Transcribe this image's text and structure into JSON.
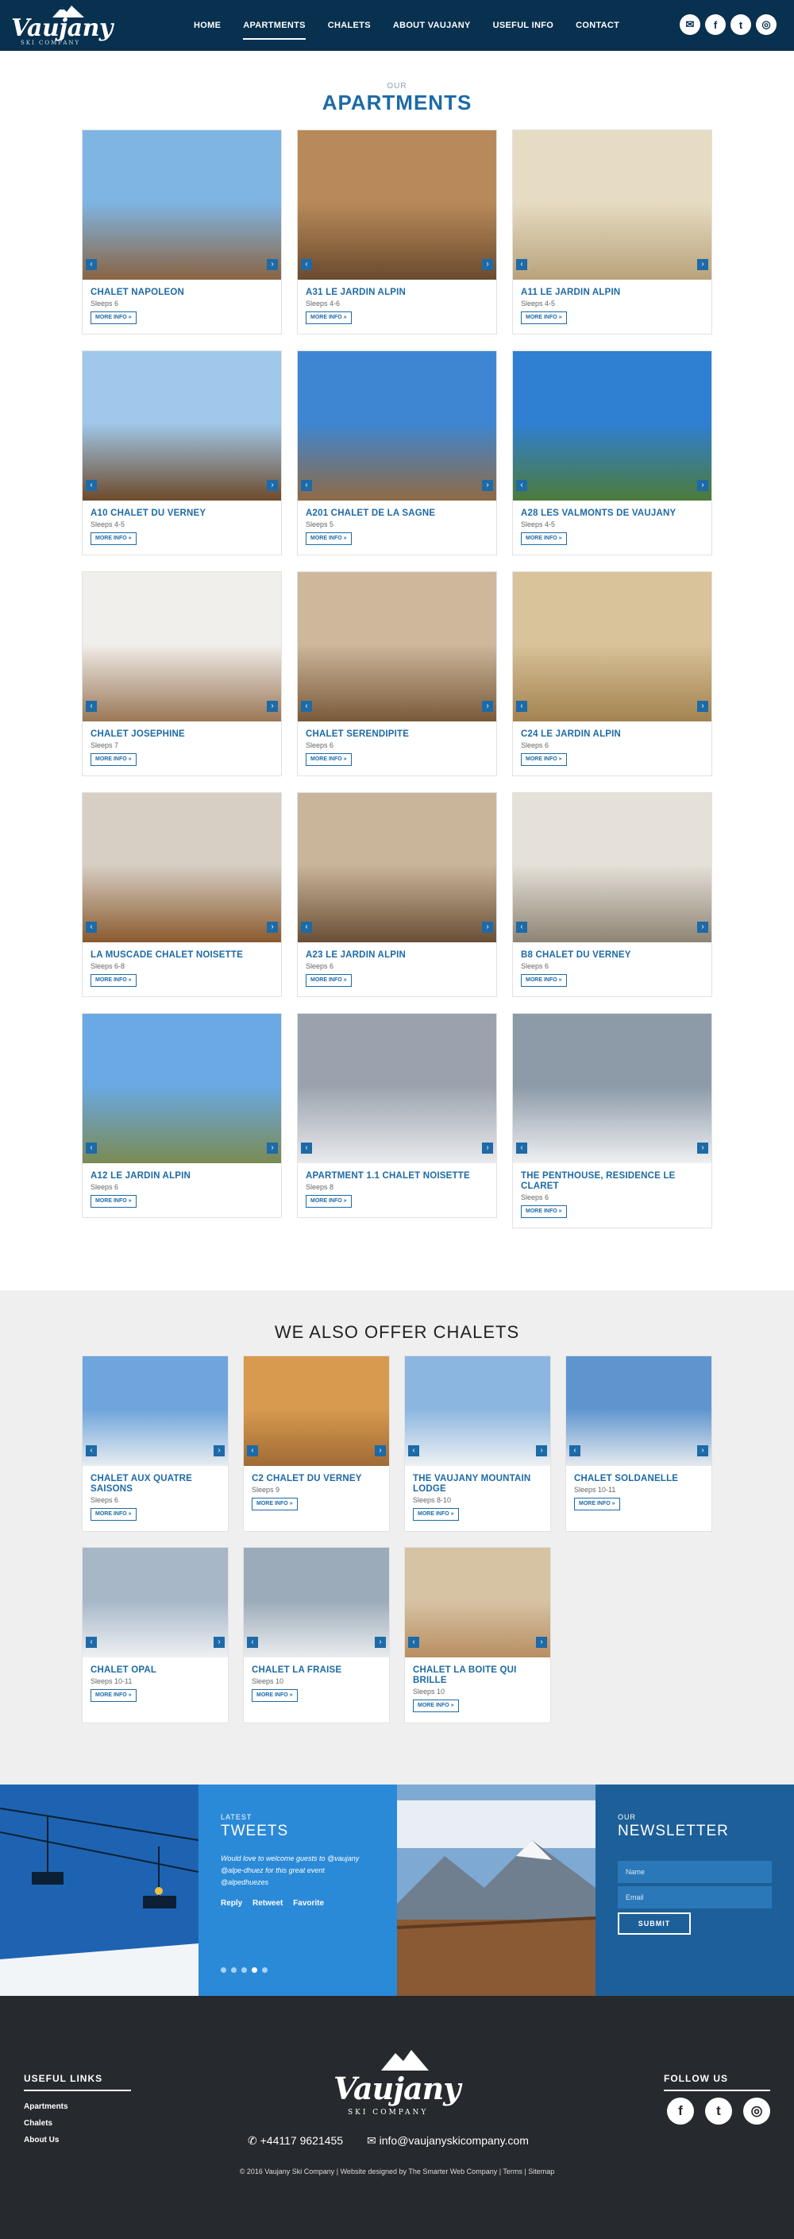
{
  "header": {
    "logo_text": "Vaujany",
    "logo_sub": "SKI COMPANY",
    "nav": [
      "HOME",
      "APARTMENTS",
      "CHALETS",
      "ABOUT VAUJANY",
      "USEFUL INFO",
      "CONTACT"
    ],
    "active_nav": "APARTMENTS",
    "social": [
      {
        "icon": "email-icon",
        "glyph": "✉"
      },
      {
        "icon": "facebook-icon",
        "glyph": "f"
      },
      {
        "icon": "twitter-icon",
        "glyph": "t"
      },
      {
        "icon": "instagram-icon",
        "glyph": "◎"
      }
    ]
  },
  "apartments": {
    "small": "OUR",
    "title": "APARTMENTS",
    "more_label": "MORE INFO »",
    "items": [
      {
        "name": "CHALET NAPOLEON",
        "sleeps": "Sleeps 6",
        "sky": "#7fb5e3",
        "ground": "#8a6442"
      },
      {
        "name": "A31 LE JARDIN ALPIN",
        "sleeps": "Sleeps 4-6",
        "sky": "#b88a5a",
        "ground": "#6b4a2e"
      },
      {
        "name": "A11 LE JARDIN ALPIN",
        "sleeps": "Sleeps 4-5",
        "sky": "#e6dcc3",
        "ground": "#b9a27a"
      },
      {
        "name": "A10 CHALET DU VERNEY",
        "sleeps": "Sleeps 4-5",
        "sky": "#9fc8ea",
        "ground": "#6e4a2a"
      },
      {
        "name": "A201 CHALET DE LA SAGNE",
        "sleeps": "Sleeps 5",
        "sky": "#3e86d1",
        "ground": "#8f6a45"
      },
      {
        "name": "A28 LES VALMONTS DE VAUJANY",
        "sleeps": "Sleeps 4-5",
        "sky": "#2f7fd3",
        "ground": "#4d7b3a"
      },
      {
        "name": "CHALET JOSEPHINE",
        "sleeps": "Sleeps 7",
        "sky": "#f1efeb",
        "ground": "#9a7756"
      },
      {
        "name": "CHALET SERENDIPITE",
        "sleeps": "Sleeps 6",
        "sky": "#cdb89c",
        "ground": "#7a5a3a"
      },
      {
        "name": "C24 LE JARDIN ALPIN",
        "sleeps": "Sleeps 6",
        "sky": "#d9c39a",
        "ground": "#a3824f"
      },
      {
        "name": "LA MUSCADE CHALET NOISETTE",
        "sleeps": "Sleeps 6-8",
        "sky": "#d7cfc4",
        "ground": "#8a5a2e"
      },
      {
        "name": "A23 LE JARDIN ALPIN",
        "sleeps": "Sleeps 6",
        "sky": "#c9b59a",
        "ground": "#6a4f35"
      },
      {
        "name": "B8 CHALET DU VERNEY",
        "sleeps": "Sleeps 6",
        "sky": "#e5e0d8",
        "ground": "#8e8474"
      },
      {
        "name": "A12 LE JARDIN ALPIN",
        "sleeps": "Sleeps 6",
        "sky": "#6aa9e3",
        "ground": "#7a8a52"
      },
      {
        "name": "APARTMENT 1.1 CHALET NOISETTE",
        "sleeps": "Sleeps 8",
        "sky": "#9aa3ad",
        "ground": "#e9eaed"
      },
      {
        "name": "THE PENTHOUSE, RESIDENCE LE CLARET",
        "sleeps": "Sleeps 6",
        "sky": "#8d9aa8",
        "ground": "#eef0f2"
      }
    ]
  },
  "chalets": {
    "title": "WE ALSO OFFER CHALETS",
    "items": [
      {
        "name": "CHALET AUX QUATRE SAISONS",
        "sleeps": "Sleeps 6",
        "sky": "#6ea5dc",
        "ground": "#e8ecf0"
      },
      {
        "name": "C2 CHALET DU VERNEY",
        "sleeps": "Sleeps 9",
        "sky": "#d79a4e",
        "ground": "#a06a35"
      },
      {
        "name": "THE VAUJANY MOUNTAIN LODGE",
        "sleeps": "Sleeps 8-10",
        "sky": "#8bb6df",
        "ground": "#eef1f4"
      },
      {
        "name": "CHALET SOLDANELLE",
        "sleeps": "Sleeps 10-11",
        "sky": "#5f95cf",
        "ground": "#e5e9ee"
      },
      {
        "name": "CHALET OPAL",
        "sleeps": "Sleeps 10-11",
        "sky": "#a7b7c8",
        "ground": "#eef0f3"
      },
      {
        "name": "CHALET LA FRAISE",
        "sleeps": "Sleeps 10",
        "sky": "#9cabb9",
        "ground": "#e9ecef"
      },
      {
        "name": "CHALET LA BOITE QUI BRILLE",
        "sleeps": "Sleeps 10",
        "sky": "#d6c3a4",
        "ground": "#b98e62"
      }
    ]
  },
  "tweets": {
    "small": "LATEST",
    "title": "TWEETS",
    "text": "Would love to welcome guests to @vaujany @alpe-dhuez for this great event @alpedhuezes",
    "actions": [
      "Reply",
      "Retweet",
      "Favorite"
    ]
  },
  "newsletter": {
    "small": "OUR",
    "title": "NEWSLETTER",
    "name_placeholder": "Name",
    "email_placeholder": "Email",
    "submit": "SUBMIT"
  },
  "footer": {
    "useful_links_title": "USEFUL LINKS",
    "links": [
      "Apartments",
      "Chalets",
      "About Us"
    ],
    "follow_title": "FOLLOW US",
    "logo_text": "Vaujany",
    "logo_sub": "SKI COMPANY",
    "phone": "+44117 9621455",
    "email": "info@vaujanyskicompany.com",
    "copyright": "© 2016 Vaujany Ski Company | Website designed by The Smarter Web Company | Terms | Sitemap",
    "social": [
      {
        "icon": "facebook-icon",
        "glyph": "f"
      },
      {
        "icon": "twitter-icon",
        "glyph": "t"
      },
      {
        "icon": "instagram-icon",
        "glyph": "◎"
      }
    ]
  }
}
